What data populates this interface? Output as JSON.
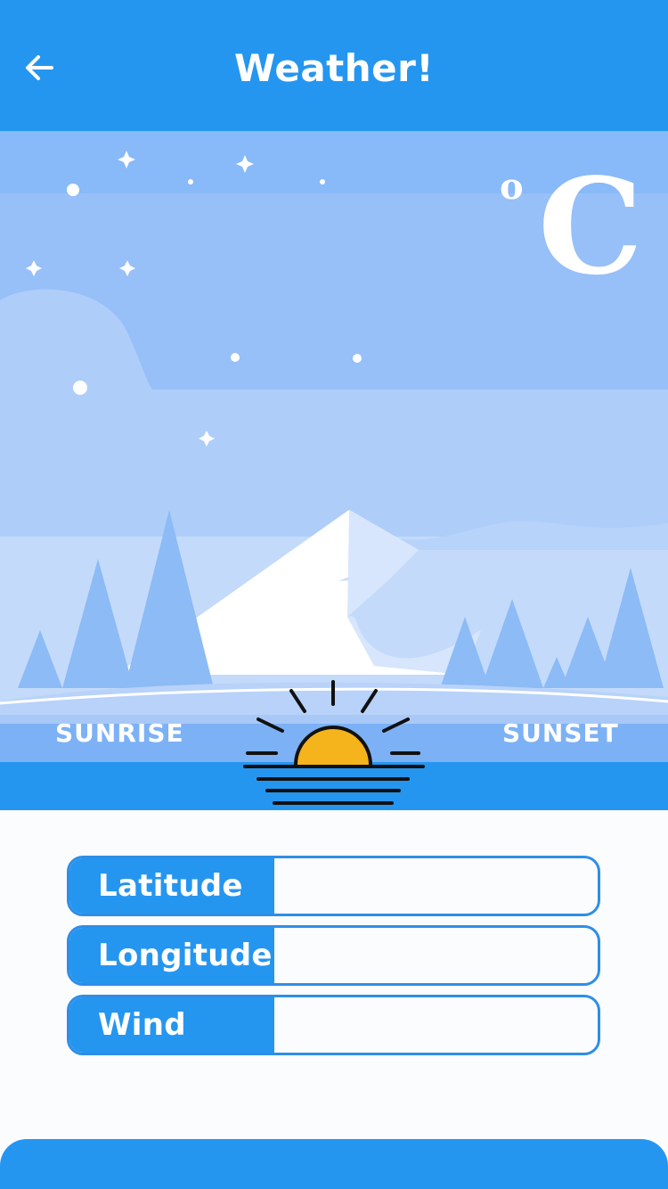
{
  "header": {
    "title": "Weather!",
    "back_icon": "arrow-left-icon"
  },
  "temperature": {
    "value": "",
    "degree_symbol": "o",
    "unit": "C"
  },
  "sun": {
    "sunrise_label": "SUNRISE",
    "sunset_label": "SUNSET",
    "icon": "sunrise-icon"
  },
  "fields": [
    {
      "label": "Latitude",
      "value": ""
    },
    {
      "label": "Longitude",
      "value": ""
    },
    {
      "label": "Wind",
      "value": ""
    }
  ],
  "colors": {
    "primary": "#2596f0",
    "sky_top": "#88b9f8",
    "sky_mid": "#9bc0f8",
    "sun": "#f5b41b",
    "white": "#ffffff"
  }
}
